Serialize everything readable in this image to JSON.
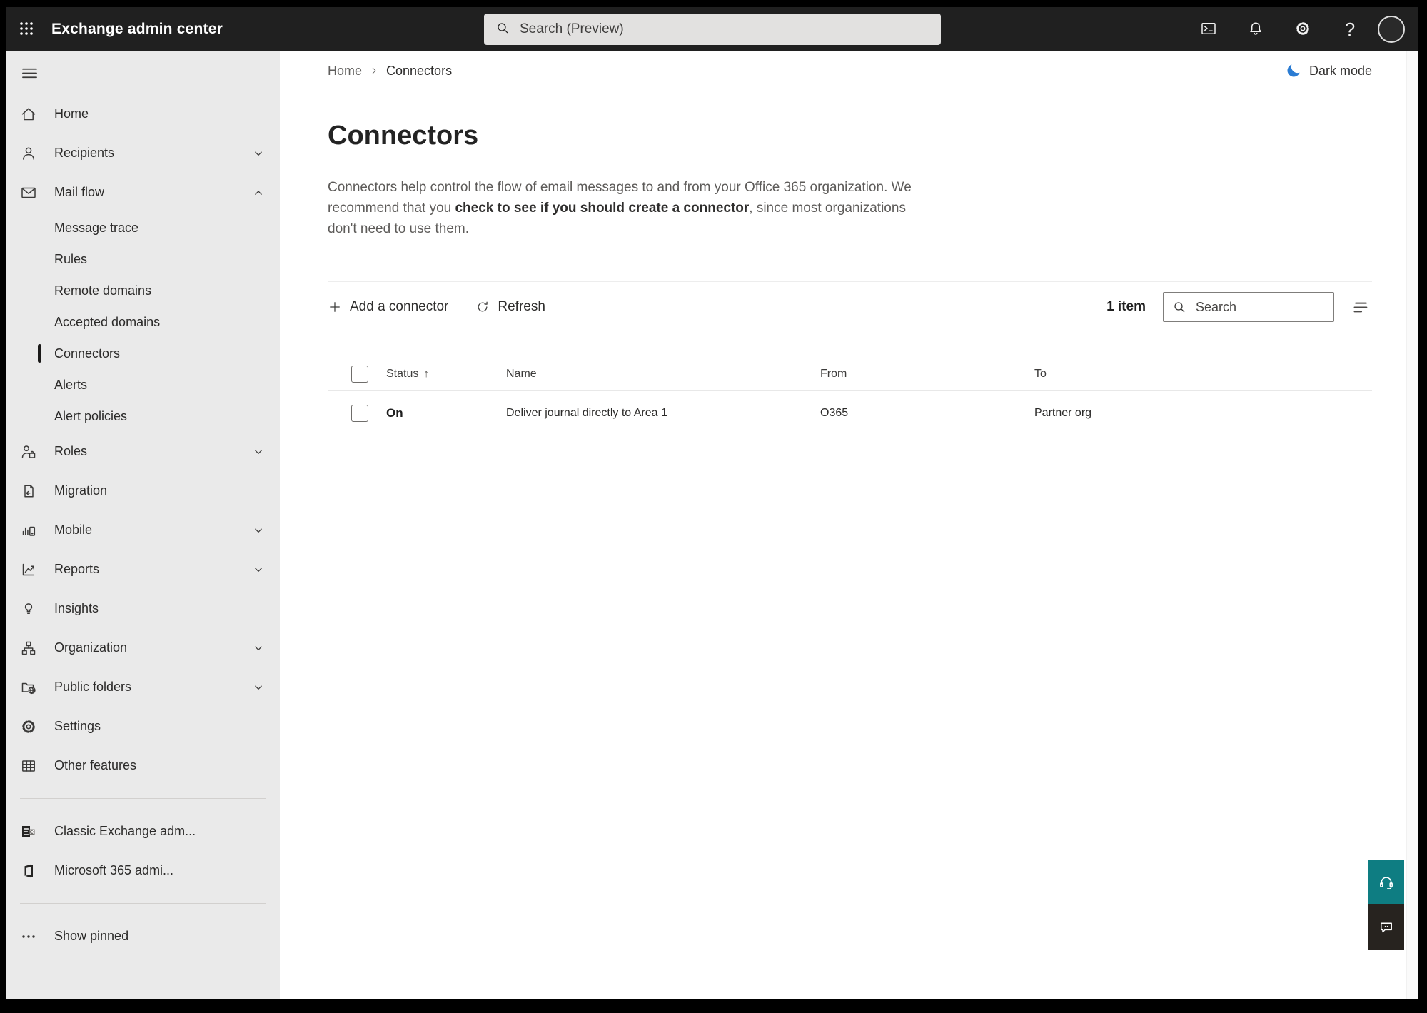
{
  "topbar": {
    "title": "Exchange admin center",
    "search_placeholder": "Search (Preview)"
  },
  "icons": {
    "gear_glyph": "⚙",
    "help_glyph": "?",
    "sort_up_glyph": "↑",
    "map": {
      "waffle-icon": "3x3 white dots grid",
      "search-icon": "magnifier",
      "terminal-icon": "console window with prompt",
      "bell-icon": "notification bell",
      "gear-icon": "settings gear",
      "help-icon": "question mark",
      "moon-icon": "blue crescent",
      "headset-icon": "support headset",
      "chat-icon": "feedback speech bubble",
      "filter-icon": "three decreasing lines"
    }
  },
  "colors": {
    "topbar_bg": "#202020",
    "sidebar_bg": "#eaeaea",
    "accent_blue": "#2b7cd3",
    "support_teal": "#0e7d82",
    "feedback_dark": "#27231f"
  },
  "sidebar": {
    "items": [
      {
        "label": "Home"
      },
      {
        "label": "Recipients"
      },
      {
        "label": "Mail flow"
      },
      {
        "label": "Message trace"
      },
      {
        "label": "Rules"
      },
      {
        "label": "Remote domains"
      },
      {
        "label": "Accepted domains"
      },
      {
        "label": "Connectors"
      },
      {
        "label": "Alerts"
      },
      {
        "label": "Alert policies"
      },
      {
        "label": "Roles"
      },
      {
        "label": "Migration"
      },
      {
        "label": "Mobile"
      },
      {
        "label": "Reports"
      },
      {
        "label": "Insights"
      },
      {
        "label": "Organization"
      },
      {
        "label": "Public folders"
      },
      {
        "label": "Settings"
      },
      {
        "label": "Other features"
      },
      {
        "label": "Classic Exchange adm..."
      },
      {
        "label": "Microsoft 365 admi..."
      },
      {
        "label": "Show pinned"
      }
    ]
  },
  "breadcrumb": {
    "items": [
      "Home",
      "Connectors"
    ]
  },
  "header": {
    "dark_mode_label": "Dark mode"
  },
  "page": {
    "title": "Connectors",
    "description_pre": "Connectors help control the flow of email messages to and from your Office 365 organization. We recommend that you ",
    "description_link": "check to see if you should create a connector",
    "description_post": ", since most organizations don't need to use them."
  },
  "toolbar": {
    "add_label": "Add a connector",
    "refresh_label": "Refresh",
    "items_count": "1 item",
    "search_placeholder": "Search"
  },
  "table": {
    "headers": [
      "Status",
      "Name",
      "From",
      "To"
    ],
    "rows": [
      {
        "status": "On",
        "name": "Deliver journal directly to Area 1",
        "from": "O365",
        "to": "Partner org"
      }
    ]
  }
}
